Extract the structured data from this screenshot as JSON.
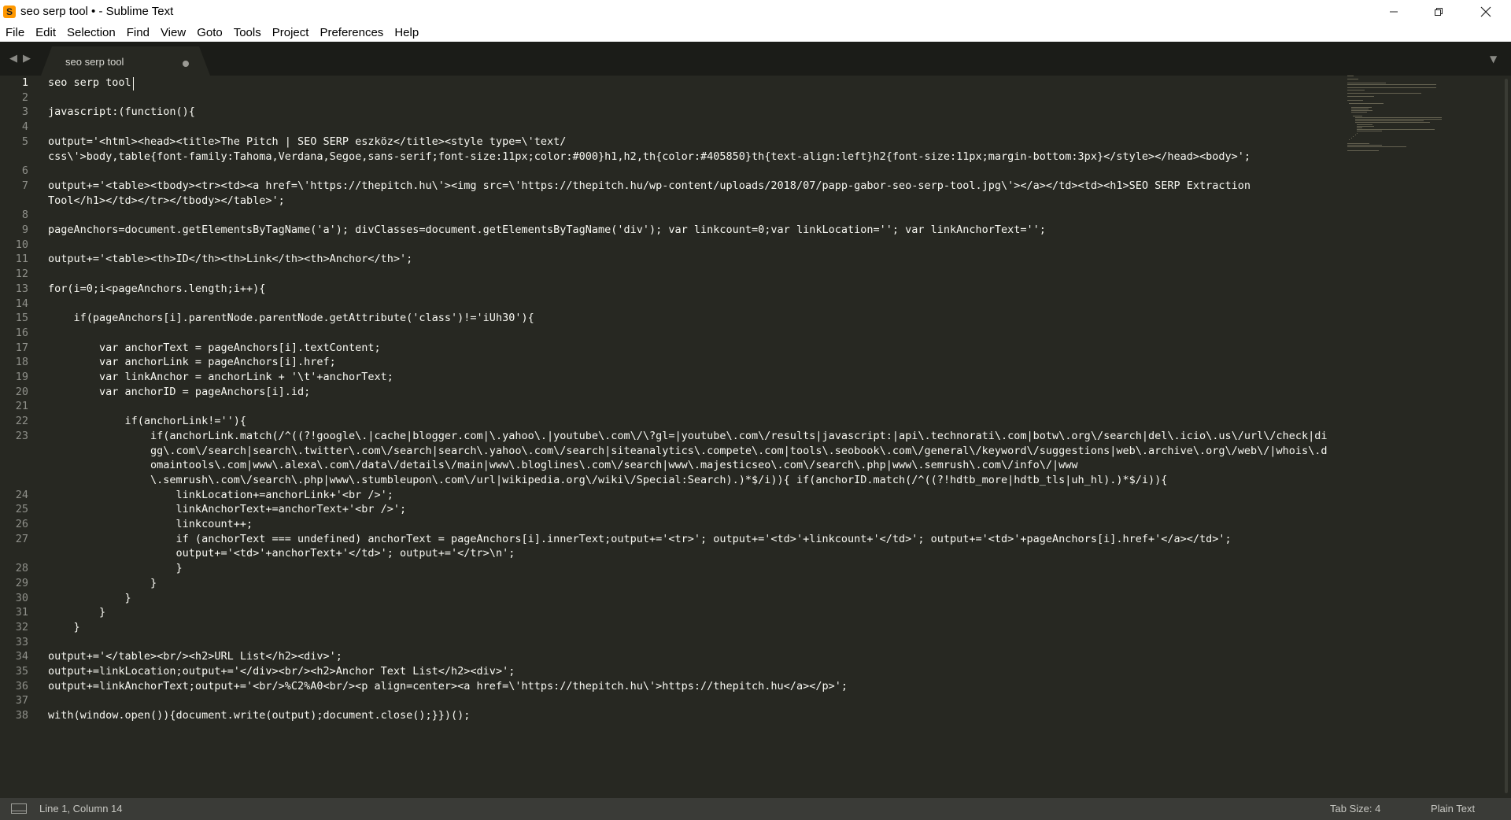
{
  "window": {
    "title": "seo serp tool • - Sublime Text",
    "app_icon": "sublime-logo-icon"
  },
  "menu": [
    "File",
    "Edit",
    "Selection",
    "Find",
    "View",
    "Goto",
    "Tools",
    "Project",
    "Preferences",
    "Help"
  ],
  "tabs": [
    {
      "label": "seo serp tool",
      "dirty": true
    }
  ],
  "editor": {
    "lines": [
      {
        "n": "1",
        "text": "seo serp tool"
      },
      {
        "n": "2",
        "text": ""
      },
      {
        "n": "3",
        "text": "javascript:(function(){"
      },
      {
        "n": "4",
        "text": ""
      },
      {
        "n": "5",
        "text": "output='<html><head><title>The Pitch | SEO SERP eszköz</title><style type=\\'text/"
      },
      {
        "n": "",
        "text": "css\\'>body,table{font-family:Tahoma,Verdana,Segoe,sans-serif;font-size:11px;color:#000}h1,h2,th{color:#405850}th{text-align:left}h2{font-size:11px;margin-bottom:3px}</style></head><body>';"
      },
      {
        "n": "6",
        "text": ""
      },
      {
        "n": "7",
        "text": "output+='<table><tbody><tr><td><a href=\\'https://thepitch.hu\\'><img src=\\'https://thepitch.hu/wp-content/uploads/2018/07/papp-gabor-seo-serp-tool.jpg\\'></a></td><td><h1>SEO SERP Extraction"
      },
      {
        "n": "",
        "text": "Tool</h1></td></tr></tbody></table>';"
      },
      {
        "n": "8",
        "text": ""
      },
      {
        "n": "9",
        "text": "pageAnchors=document.getElementsByTagName('a'); divClasses=document.getElementsByTagName('div'); var linkcount=0;var linkLocation=''; var linkAnchorText='';"
      },
      {
        "n": "10",
        "text": ""
      },
      {
        "n": "11",
        "text": "output+='<table><th>ID</th><th>Link</th><th>Anchor</th>';"
      },
      {
        "n": "12",
        "text": ""
      },
      {
        "n": "13",
        "text": "for(i=0;i<pageAnchors.length;i++){"
      },
      {
        "n": "14",
        "text": ""
      },
      {
        "n": "15",
        "text": "    if(pageAnchors[i].parentNode.parentNode.getAttribute('class')!='iUh30'){"
      },
      {
        "n": "16",
        "text": ""
      },
      {
        "n": "17",
        "text": "        var anchorText = pageAnchors[i].textContent;"
      },
      {
        "n": "18",
        "text": "        var anchorLink = pageAnchors[i].href;"
      },
      {
        "n": "19",
        "text": "        var linkAnchor = anchorLink + '\\t'+anchorText;"
      },
      {
        "n": "20",
        "text": "        var anchorID = pageAnchors[i].id;"
      },
      {
        "n": "21",
        "text": ""
      },
      {
        "n": "22",
        "text": "            if(anchorLink!=''){"
      },
      {
        "n": "23",
        "text": "                if(anchorLink.match(/^((?!google\\.|cache|blogger.com|\\.yahoo\\.|youtube\\.com\\/\\?gl=|youtube\\.com\\/results|javascript:|api\\.technorati\\.com|botw\\.org\\/search|del\\.icio\\.us\\/url\\/check|di"
      },
      {
        "n": "",
        "text": "                gg\\.com\\/search|search\\.twitter\\.com\\/search|search\\.yahoo\\.com\\/search|siteanalytics\\.compete\\.com|tools\\.seobook\\.com\\/general\\/keyword\\/suggestions|web\\.archive\\.org\\/web\\/|whois\\.d"
      },
      {
        "n": "",
        "text": "                omaintools\\.com|www\\.alexa\\.com\\/data\\/details\\/main|www\\.bloglines\\.com\\/search|www\\.majesticseo\\.com\\/search\\.php|www\\.semrush\\.com\\/info\\/|www"
      },
      {
        "n": "",
        "text": "                \\.semrush\\.com\\/search\\.php|www\\.stumbleupon\\.com\\/url|wikipedia.org\\/wiki\\/Special:Search).)*$/i)){ if(anchorID.match(/^((?!hdtb_more|hdtb_tls|uh_hl).)*$/i)){"
      },
      {
        "n": "24",
        "text": "                    linkLocation+=anchorLink+'<br />';"
      },
      {
        "n": "25",
        "text": "                    linkAnchorText+=anchorText+'<br />';"
      },
      {
        "n": "26",
        "text": "                    linkcount++;"
      },
      {
        "n": "27",
        "text": "                    if (anchorText === undefined) anchorText = pageAnchors[i].innerText;output+='<tr>'; output+='<td>'+linkcount+'</td>'; output+='<td>'+pageAnchors[i].href+'</a></td>';"
      },
      {
        "n": "",
        "text": "                    output+='<td>'+anchorText+'</td>'; output+='</tr>\\n';"
      },
      {
        "n": "28",
        "text": "                    }"
      },
      {
        "n": "29",
        "text": "                }"
      },
      {
        "n": "30",
        "text": "            }"
      },
      {
        "n": "31",
        "text": "        }"
      },
      {
        "n": "32",
        "text": "    }"
      },
      {
        "n": "33",
        "text": ""
      },
      {
        "n": "34",
        "text": "output+='</table><br/><h2>URL List</h2><div>';"
      },
      {
        "n": "35",
        "text": "output+=linkLocation;output+='</div><br/><h2>Anchor Text List</h2><div>';"
      },
      {
        "n": "36",
        "text": "output+=linkAnchorText;output+='<br/>%C2%A0<br/><p align=center><a href=\\'https://thepitch.hu\\'>https://thepitch.hu</a></p>';"
      },
      {
        "n": "37",
        "text": ""
      },
      {
        "n": "38",
        "text": "with(window.open()){document.write(output);document.close();}})();"
      }
    ]
  },
  "status": {
    "position": "Line 1, Column 14",
    "tab_size": "Tab Size: 4",
    "syntax": "Plain Text"
  },
  "colors": {
    "editor_bg": "#272822",
    "tabbar_bg": "#1b1c18",
    "statusbar_bg": "#3a3b37",
    "text": "#f8f8f2",
    "gutter_text": "#8f908a"
  }
}
